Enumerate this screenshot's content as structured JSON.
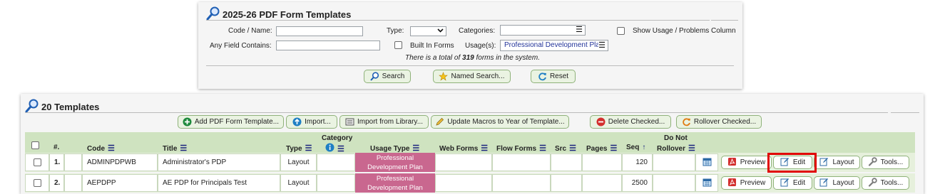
{
  "search_panel": {
    "title": "2025-26 PDF Form Templates",
    "code_name_label": "Code / Name:",
    "code_name_value": "",
    "type_label": "Type:",
    "type_value": "",
    "categories_label": "Categories:",
    "categories_value": "",
    "show_usage_label": "Show Usage / Problems Column",
    "any_field_label": "Any Field Contains:",
    "any_field_value": "",
    "built_in_label": "Built In Forms",
    "usages_label": "Usage(s):",
    "usages_value": "Professional Development Pla",
    "total_prefix": "There is a total of ",
    "total_count": "319",
    "total_suffix": " forms in the system.",
    "search_label": "Search",
    "named_search_label": "Named Search...",
    "reset_label": "Reset"
  },
  "templates_panel": {
    "title": "20 Templates",
    "toolbar": {
      "add_label": "Add PDF Form Template...",
      "import_label": "Import...",
      "import_library_label": "Import from Library...",
      "update_macros_label": "Update Macros to Year of Template...",
      "delete_label": "Delete Checked...",
      "rollover_label": "Rollover Checked..."
    },
    "columns": {
      "num": "#.",
      "code": "Code",
      "title": "Title",
      "type": "Type",
      "category": "Category",
      "usage_type": "Usage Type",
      "web_forms": "Web Forms",
      "flow_forms": "Flow Forms",
      "src": "Src",
      "pages": "Pages",
      "seq": "Seq",
      "do_not": "Do Not",
      "rollover": "Rollover"
    },
    "rows": [
      {
        "num": "1.",
        "code": "ADMINPDPWB",
        "title": "Administrator's PDP",
        "type": "Layout",
        "usage": "Professional Development Plan",
        "seq": "120"
      },
      {
        "num": "2.",
        "code": "AEPDPP",
        "title": "AE PDP for Principals Test",
        "type": "Layout",
        "usage": "Professional Development Plan",
        "seq": "2500"
      }
    ],
    "row_actions": {
      "preview": "Preview",
      "edit": "Edit",
      "layout": "Layout",
      "tools": "Tools..."
    }
  },
  "colors": {
    "accent_green": "#cfe3c0",
    "usage_pink": "#c9678f",
    "highlight_red": "#e00000"
  }
}
